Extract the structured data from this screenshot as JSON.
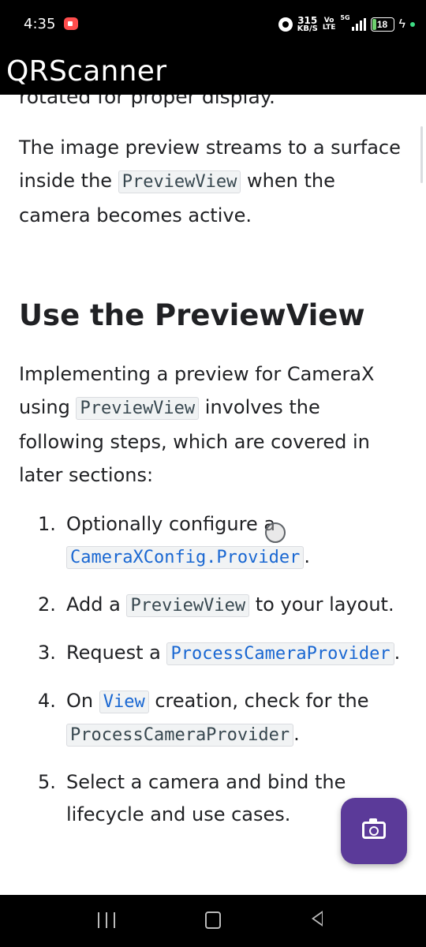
{
  "status_bar": {
    "time": "4:35",
    "net_speed_value": "315",
    "net_speed_unit": "KB/S",
    "volte_top": "Vo",
    "volte_bottom": "LTE",
    "network_type": "5G",
    "battery_level": "18"
  },
  "app_bar": {
    "title": "QRScanner"
  },
  "content": {
    "cut_off_line": "rotated for proper display.",
    "para1_text1": "The image preview streams to a surface inside the ",
    "para1_code": "PreviewView",
    "para1_text2": " when the camera becomes active.",
    "heading": "Use the PreviewView",
    "para2_text1": "Implementing a preview for CameraX using ",
    "para2_code": "PreviewView",
    "para2_text2": " involves the following steps, which are covered in later sections:",
    "steps": [
      {
        "num": "1.",
        "text1": "Optionally configure a ",
        "code": "CameraXConfig.Provider",
        "text2": "."
      },
      {
        "num": "2.",
        "text1": "Add a ",
        "code": "PreviewView",
        "text2": " to your layout."
      },
      {
        "num": "3.",
        "text1": "Request a ",
        "code": "ProcessCameraProvider",
        "text2": "."
      },
      {
        "num": "4.",
        "text1": "On ",
        "code": "View",
        "text2": " creation, check for the ",
        "code2": "ProcessCameraProvider",
        "text3": "."
      },
      {
        "num": "5.",
        "text1": "Select a camera and bind the lifecycle and use cases."
      }
    ]
  },
  "fab": {
    "icon": "camera-icon"
  },
  "colors": {
    "fab": "#5b3a99",
    "link_code": "#1967d2",
    "text": "#202124"
  }
}
